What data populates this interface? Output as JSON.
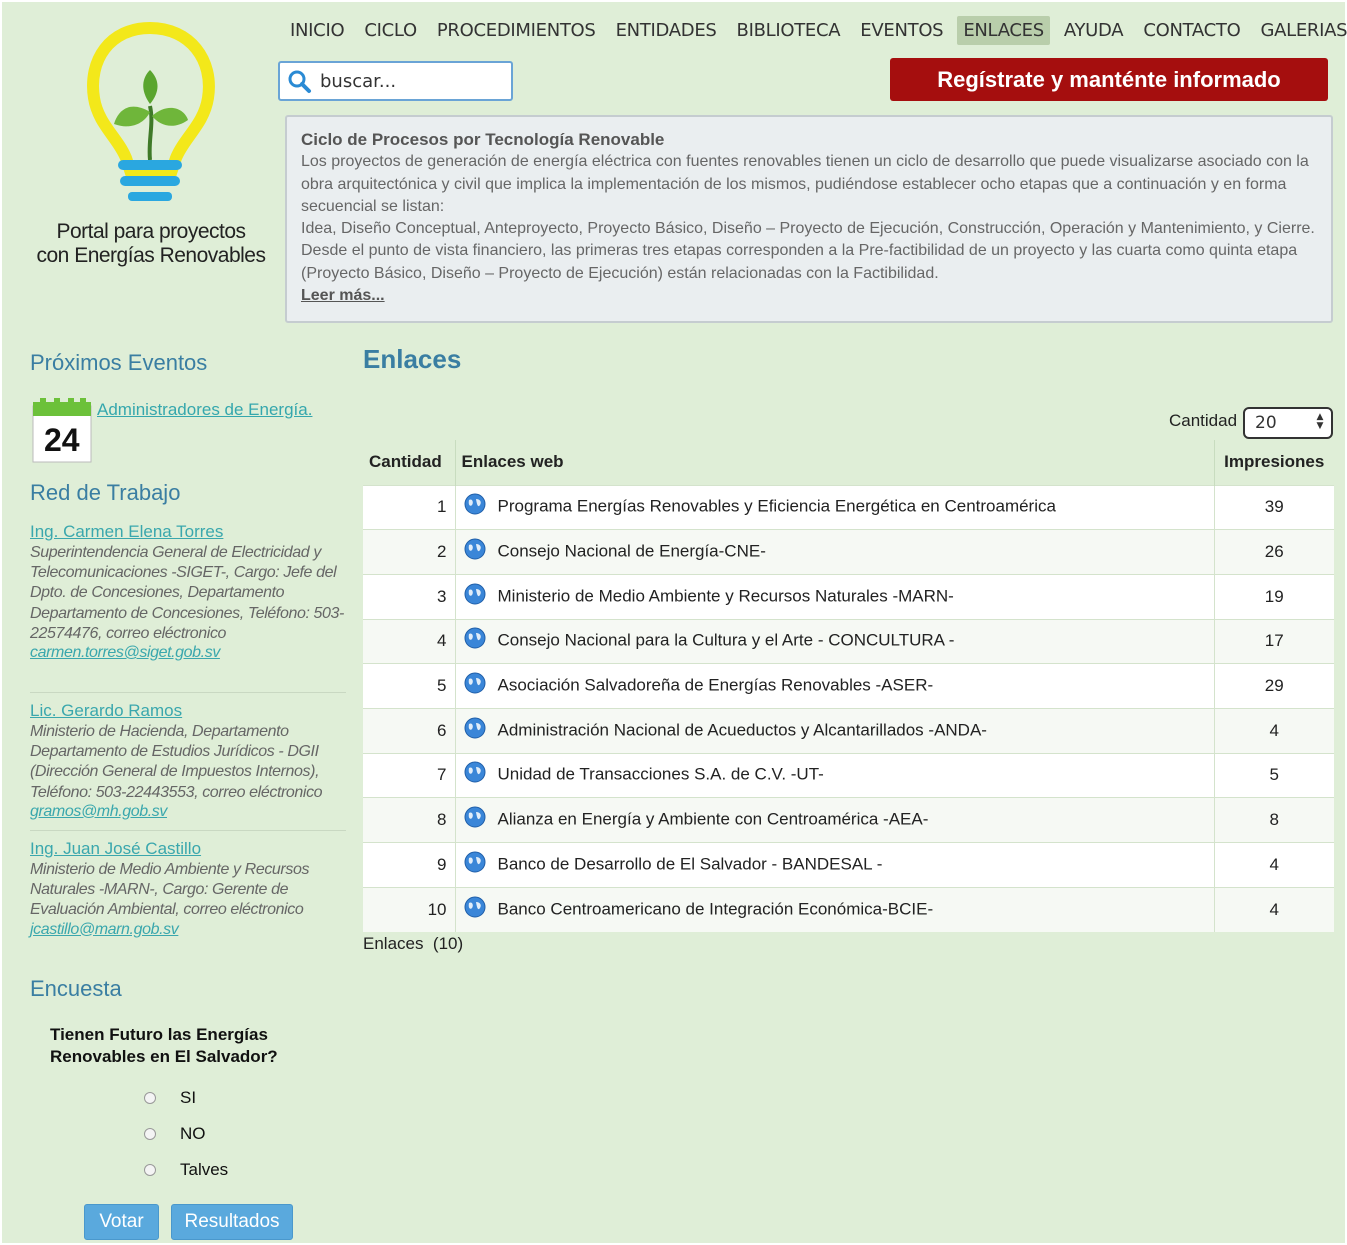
{
  "brand": {
    "line1": "Portal para proyectos",
    "line2": "con Energías Renovables"
  },
  "nav": {
    "items": [
      {
        "label": "INICIO"
      },
      {
        "label": "CICLO"
      },
      {
        "label": "PROCEDIMIENTOS"
      },
      {
        "label": "ENTIDADES"
      },
      {
        "label": "BIBLIOTECA"
      },
      {
        "label": "EVENTOS"
      },
      {
        "label": "ENLACES",
        "active": true
      },
      {
        "label": "AYUDA"
      },
      {
        "label": "CONTACTO"
      },
      {
        "label": "GALERIAS"
      }
    ]
  },
  "search": {
    "placeholder": "buscar...",
    "icon": "search-icon"
  },
  "register": {
    "label": "Regístrate y manténte informado",
    "color": "#a50e0e"
  },
  "info": {
    "title": "Ciclo de Procesos por Tecnología Renovable",
    "body": "Los proyectos de generación de energía eléctrica con fuentes renovables tienen un ciclo de desarrollo que puede visualizarse asociado con la obra arquitectónica y civil que implica la implementación de los mismos, pudiéndose establecer ocho etapas que a continuación y en forma secuencial se listan:",
    "body2": "Idea, Diseño Conceptual, Anteproyecto, Proyecto Básico, Diseño – Proyecto de Ejecución, Construcción, Operación y Mantenimiento, y Cierre. Desde el punto de vista financiero, las primeras tres etapas corresponden a la Pre-factibilidad de un proyecto y las cuarta como quinta etapa (Proyecto Básico, Diseño – Proyecto de Ejecución) están relacionadas con la Factibilidad.",
    "more": "Leer más..."
  },
  "sidebar": {
    "events_title": "Próximos Eventos",
    "event": {
      "day": "24",
      "label": "Administradores de Energía."
    },
    "network_title": "Red de Trabajo",
    "contacts": [
      {
        "name": "Ing. Carmen Elena Torres",
        "desc": "Superintendencia General de Electricidad y Telecomunicaciones -SIGET-, Cargo: Jefe del Dpto. de Concesiones, Departamento Departamento de Concesiones, Teléfono: 503-22574476, correo eléctronico ",
        "email": "carmen.torres@siget.gob.sv"
      },
      {
        "name": "Lic. Gerardo Ramos",
        "desc": "Ministerio de Hacienda, Departamento Departamento de Estudios Jurídicos - DGII (Dirección General de Impuestos Internos), Teléfono: 503-22443553, correo eléctronico ",
        "email": "gramos@mh.gob.sv"
      },
      {
        "name": "Ing. Juan José Castillo",
        "desc": "Ministerio de Medio Ambiente y Recursos Naturales -MARN-, Cargo: Gerente de Evaluación Ambiental, correo eléctronico ",
        "email": "jcastillo@marn.gob.sv"
      }
    ],
    "poll_title": "Encuesta",
    "poll_question": "Tienen Futuro las Energías Renovables en El Salvador?",
    "poll_options": [
      "SI",
      "NO",
      "Talves"
    ],
    "vote_label": "Votar",
    "results_label": "Resultados"
  },
  "main": {
    "title": "Enlaces",
    "cantidad_label": "Cantidad",
    "cantidad_value": "20",
    "columns": [
      "Cantidad",
      "Enlaces web",
      "Impresiones"
    ],
    "rows": [
      {
        "n": "1",
        "link": "Programa Energías Renovables y Eficiencia Energética en Centroamérica",
        "imp": "39"
      },
      {
        "n": "2",
        "link": "Consejo Nacional de Energía-CNE-",
        "imp": "26"
      },
      {
        "n": "3",
        "link": "Ministerio de Medio Ambiente y Recursos Naturales -MARN-",
        "imp": "19"
      },
      {
        "n": "4",
        "link": "Consejo Nacional para la Cultura y el Arte - CONCULTURA -",
        "imp": "17"
      },
      {
        "n": "5",
        "link": "Asociación Salvadoreña de Energías Renovables -ASER-",
        "imp": "29"
      },
      {
        "n": "6",
        "link": "Administración Nacional de Acueductos y Alcantarillados -ANDA-",
        "imp": "4"
      },
      {
        "n": "7",
        "link": "Unidad de Transacciones S.A. de C.V. -UT-",
        "imp": "5"
      },
      {
        "n": "8",
        "link": "Alianza en Energía y Ambiente con Centroamérica -AEA-",
        "imp": "8"
      },
      {
        "n": "9",
        "link": "Banco de Desarrollo de El Salvador - BANDESAL -",
        "imp": "4"
      },
      {
        "n": "10",
        "link": "Banco Centroamericano de Integración Económica-BCIE-",
        "imp": "4"
      }
    ],
    "footer": "Enlaces  (10)"
  },
  "colors": {
    "background": "#dfeed7",
    "accent": "#3a7ea2",
    "link": "#35a7ad",
    "button": "#5aa9dd"
  }
}
